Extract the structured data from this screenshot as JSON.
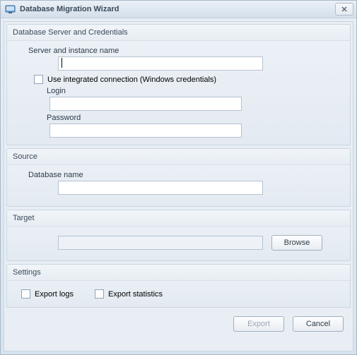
{
  "title": "Database Migration Wizard",
  "groups": {
    "credentials": {
      "title": "Database Server and Credentials",
      "server_label": "Server and instance name",
      "server_value": "",
      "integrated_label": "Use integrated connection (Windows credentials)",
      "integrated_checked": false,
      "login_label": "Login",
      "login_value": "",
      "password_label": "Password",
      "password_value": ""
    },
    "source": {
      "title": "Source",
      "db_label": "Database name",
      "db_value": ""
    },
    "target": {
      "title": "Target",
      "path_value": "",
      "browse_label": "Browse"
    },
    "settings": {
      "title": "Settings",
      "export_logs_label": "Export logs",
      "export_logs_checked": false,
      "export_stats_label": "Export statistics",
      "export_stats_checked": false
    }
  },
  "buttons": {
    "export": "Export",
    "cancel": "Cancel"
  }
}
